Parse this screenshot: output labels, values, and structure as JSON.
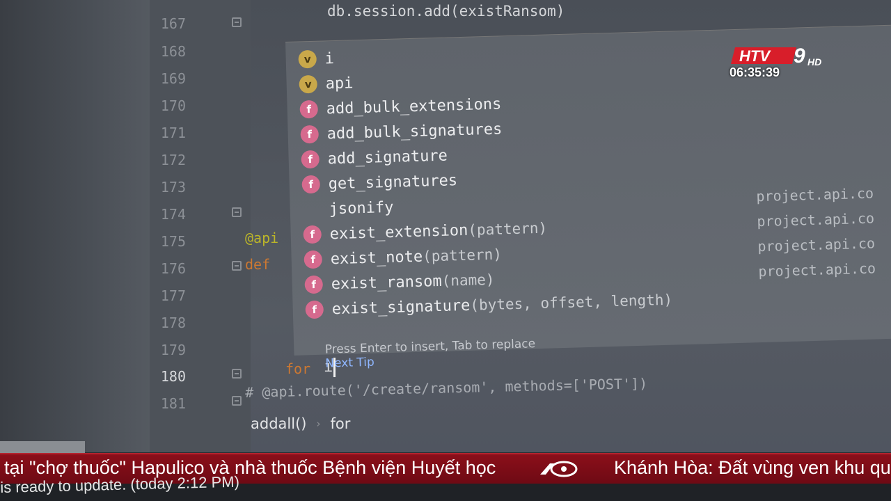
{
  "editor": {
    "line_numbers": [
      "167",
      "168",
      "169",
      "170",
      "171",
      "172",
      "173",
      "174",
      "175",
      "176",
      "177",
      "178",
      "179",
      "180",
      "181"
    ],
    "current_line": "180",
    "code_top": "db.session.add(existRansom)",
    "decorator_fragment": "@api",
    "def_fragment": "def",
    "typed_keyword": "for",
    "typed_var": "i",
    "comment_line": "# @api.route('/create/ransom', methods=['POST'])"
  },
  "completion": {
    "items": [
      {
        "kind": "v",
        "name": "i",
        "sig": "",
        "module": ""
      },
      {
        "kind": "v",
        "name": "api",
        "sig": "",
        "module": ""
      },
      {
        "kind": "f",
        "name": "add_bulk_extensions",
        "sig": "",
        "module": ""
      },
      {
        "kind": "f",
        "name": "add_bulk_signatures",
        "sig": "",
        "module": ""
      },
      {
        "kind": "f",
        "name": "add_signature",
        "sig": "",
        "module": ""
      },
      {
        "kind": "f",
        "name": "get_signatures",
        "sig": "",
        "module": ""
      },
      {
        "kind": "",
        "name": "jsonify",
        "sig": "",
        "module": "project.api.co"
      },
      {
        "kind": "f",
        "name": "exist_extension",
        "sig": "(pattern)",
        "module": "project.api.co"
      },
      {
        "kind": "f",
        "name": "exist_note",
        "sig": "(pattern)",
        "module": "project.api.co"
      },
      {
        "kind": "f",
        "name": "exist_ransom",
        "sig": "(name)",
        "module": "project.api.co"
      },
      {
        "kind": "f",
        "name": "exist_signature",
        "sig": "(bytes, offset, length)",
        "module": ""
      }
    ],
    "footer_hint": "Press Enter to insert, Tab to replace",
    "footer_tip": "Next Tip"
  },
  "breadcrumb": {
    "items": [
      "addall()",
      "for"
    ]
  },
  "overlay": {
    "channel_logo": "HTV9 HD",
    "clock": "06:35:39",
    "ticker_left": "tại \"chợ thuốc\" Hapulico và nhà thuốc Bệnh viện Huyết học",
    "ticker_right": "Khánh Hòa: Đất vùng ven khu qu",
    "status_text": "is ready to update. (today 2:12 PM)"
  },
  "colors": {
    "ticker_bg": "#8b0f1a",
    "keyword": "#cc7832",
    "decorator": "#bbb529",
    "badge_v": "#c9a84a",
    "badge_f": "#d66a8e",
    "next_tip": "#8fb6ff"
  }
}
